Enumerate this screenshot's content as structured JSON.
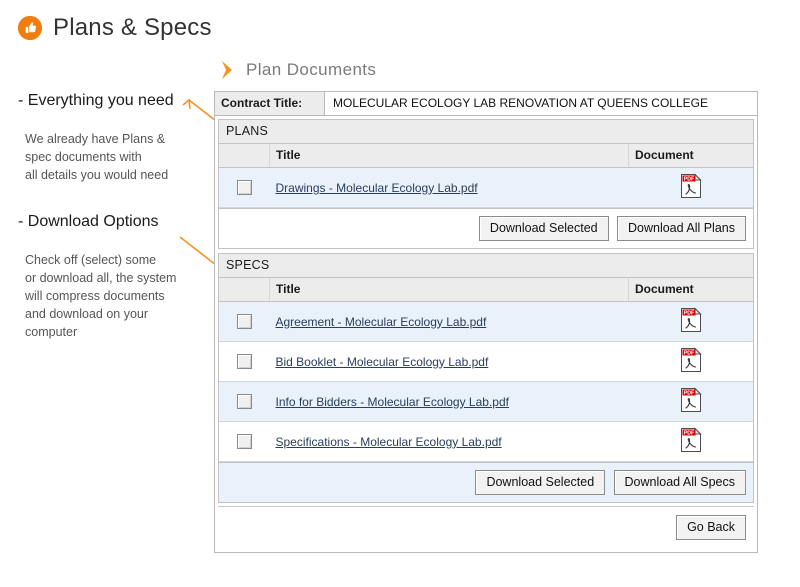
{
  "page": {
    "title": "Plans & Specs",
    "title_icon": "thumbs-up-icon",
    "accent_color": "#F07D10",
    "link_color": "#2B3D5C",
    "row_highlight_color": "#E9F1FB"
  },
  "annotations": [
    {
      "heading": "- Everything you need",
      "body": "We already have Plans &\nspec documents with\nall details you would need"
    },
    {
      "heading": "- Download Options",
      "body": "Check off (select) some\nor download all, the system\nwill compress documents\nand download on your\ncomputer"
    }
  ],
  "section_header": {
    "icon": "chevron-right-icon",
    "label": "Plan Documents"
  },
  "contract": {
    "label": "Contract Title:",
    "value": "MOLECULAR ECOLOGY LAB RENOVATION AT QUEENS COLLEGE"
  },
  "sections": [
    {
      "name": "plans",
      "title": "PLANS",
      "columns": {
        "check": "",
        "title": "Title",
        "document": "Document"
      },
      "rows": [
        {
          "title": "Drawings - Molecular Ecology Lab.pdf",
          "document_icon": "pdf-icon",
          "checked": false
        }
      ],
      "actions": [
        {
          "name": "download-selected",
          "label": "Download Selected"
        },
        {
          "name": "download-all-plans",
          "label": "Download All Plans"
        }
      ]
    },
    {
      "name": "specs",
      "title": "SPECS",
      "columns": {
        "check": "",
        "title": "Title",
        "document": "Document"
      },
      "rows": [
        {
          "title": "Agreement - Molecular Ecology Lab.pdf",
          "document_icon": "pdf-icon",
          "checked": false
        },
        {
          "title": "Bid Booklet - Molecular Ecology Lab.pdf",
          "document_icon": "pdf-icon",
          "checked": false
        },
        {
          "title": "Info for Bidders - Molecular Ecology Lab.pdf",
          "document_icon": "pdf-icon",
          "checked": false
        },
        {
          "title": "Specifications - Molecular Ecology Lab.pdf",
          "document_icon": "pdf-icon",
          "checked": false
        }
      ],
      "actions": [
        {
          "name": "download-selected",
          "label": "Download Selected"
        },
        {
          "name": "download-all-specs",
          "label": "Download All Specs"
        }
      ]
    }
  ],
  "footer": {
    "go_back_label": "Go Back"
  }
}
